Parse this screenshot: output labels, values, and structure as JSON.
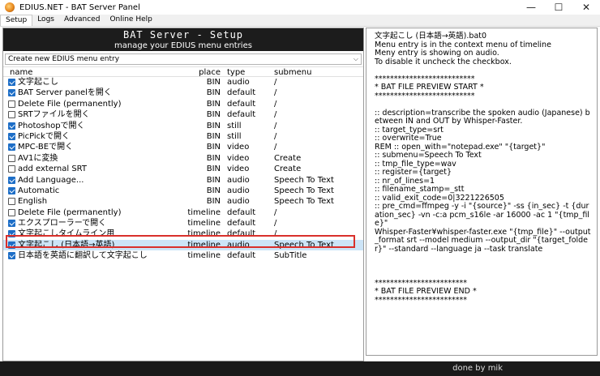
{
  "window": {
    "title": "EDIUS.NET - BAT Server Panel",
    "minimize": "—",
    "maximize": "☐",
    "close": "✕"
  },
  "menu": {
    "tabs": [
      "Setup",
      "Logs",
      "Advanced",
      "Online Help"
    ],
    "active": "Setup"
  },
  "header": {
    "title": "BAT Server - Setup",
    "subtitle": "manage your EDIUS menu entries"
  },
  "entry_select": {
    "value": "Create new EDIUS menu entry"
  },
  "table": {
    "columns": [
      "name",
      "place",
      "type",
      "submenu"
    ],
    "rows": [
      {
        "checked": true,
        "name": "文字起こし",
        "place": "BIN",
        "type": "audio",
        "submenu": "/"
      },
      {
        "checked": true,
        "name": "BAT Server panelを開く",
        "place": "BIN",
        "type": "default",
        "submenu": "/"
      },
      {
        "checked": false,
        "name": "Delete File (permanently)",
        "place": "BIN",
        "type": "default",
        "submenu": "/"
      },
      {
        "checked": false,
        "name": "SRTファイルを開く",
        "place": "BIN",
        "type": "default",
        "submenu": "/"
      },
      {
        "checked": true,
        "name": "Photoshopで開く",
        "place": "BIN",
        "type": "still",
        "submenu": "/"
      },
      {
        "checked": true,
        "name": "PicPickで開く",
        "place": "BIN",
        "type": "still",
        "submenu": "/"
      },
      {
        "checked": true,
        "name": "MPC-BEで開く",
        "place": "BIN",
        "type": "video",
        "submenu": "/"
      },
      {
        "checked": false,
        "name": "AV1に変換",
        "place": "BIN",
        "type": "video",
        "submenu": "Create"
      },
      {
        "checked": false,
        "name": "add external SRT",
        "place": "BIN",
        "type": "video",
        "submenu": "Create"
      },
      {
        "checked": true,
        "name": "Add Language...",
        "place": "BIN",
        "type": "audio",
        "submenu": "Speech To Text"
      },
      {
        "checked": true,
        "name": "Automatic",
        "place": "BIN",
        "type": "audio",
        "submenu": "Speech To Text"
      },
      {
        "checked": false,
        "name": "English",
        "place": "BIN",
        "type": "audio",
        "submenu": "Speech To Text"
      },
      {
        "checked": false,
        "name": "Delete File (permanently)",
        "place": "timeline",
        "type": "default",
        "submenu": "/"
      },
      {
        "checked": true,
        "name": "エクスプローラーで開く",
        "place": "timeline",
        "type": "default",
        "submenu": "/"
      },
      {
        "checked": true,
        "name": "文字起こしタイムライン用",
        "place": "timeline",
        "type": "default",
        "submenu": "/"
      },
      {
        "checked": true,
        "name": "文字起こし (日本語→英語)",
        "place": "timeline",
        "type": "audio",
        "submenu": "Speech To Text",
        "selected": true
      },
      {
        "checked": true,
        "name": "日本語を英語に翻訳して文字起こし",
        "place": "timeline",
        "type": "default",
        "submenu": "SubTitle"
      }
    ]
  },
  "preview": {
    "text": "文字起こし (日本語→英語).bat0\nMenu entry is in the context menu of timeline\nMeny entry is showing on audio.\nTo disable it uncheck the checkbox.\n\n**************************\n* BAT FILE PREVIEW START *\n**************************\n\n:: description=transcribe the spoken audio (Japanese) between IN and OUT by Whisper-Faster.\n:: target_type=srt\n:: overwrite=True\nREM :: open_with=\"notepad.exe\" \"{target}\"\n:: submenu=Speech To Text\n:: tmp_file_type=wav\n:: register={target}\n:: nr_of_lines=1\n:: filename_stamp=_stt\n:: valid_exit_code=0|3221226505\n:: pre_cmd=ffmpeg -y -i \"{source}\" -ss {in_sec} -t {duration_sec} -vn -c:a pcm_s16le -ar 16000 -ac 1 \"{tmp_file}\"\nWhisper-Faster¥whisper-faster.exe \"{tmp_file}\" --output_format srt --model medium --output_dir \"{target_folder}\" --standard --language ja --task translate\n\n\n\n************************\n* BAT FILE PREVIEW END *\n************************"
  },
  "status": {
    "text": "done by mik"
  },
  "colors": {
    "checkbox_checked": "#1d6ec7",
    "selection": "#cce4f7",
    "highlight_border": "#d9302b",
    "banner": "#1c1c1c"
  }
}
